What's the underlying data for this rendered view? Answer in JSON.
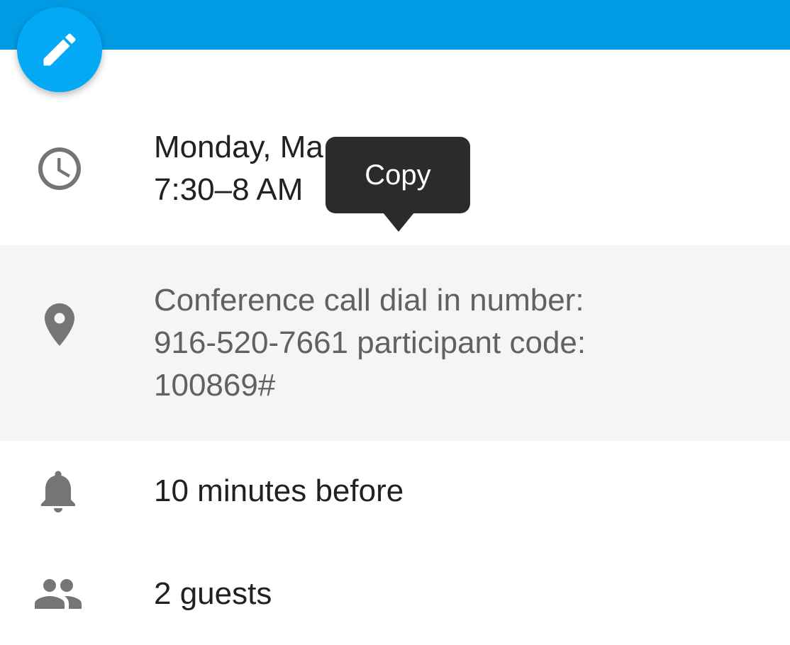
{
  "header": {
    "background_color": "#009be3",
    "edit_button": {
      "icon": "pencil-icon",
      "color": "#03a9f4"
    }
  },
  "event": {
    "date_line": "Monday, Ma",
    "time_line": "7:30–8 AM",
    "time_icon": "clock-icon",
    "location_lines": [
      "Conference call dial in number:",
      "916-520-7661  participant code:",
      "100869#"
    ],
    "location_icon": "location-pin-icon",
    "reminder": "10 minutes before",
    "reminder_icon": "bell-icon",
    "guests": "2 guests",
    "guests_icon": "people-icon"
  },
  "tooltip": {
    "label": "Copy",
    "background": "#2b2b2b"
  }
}
